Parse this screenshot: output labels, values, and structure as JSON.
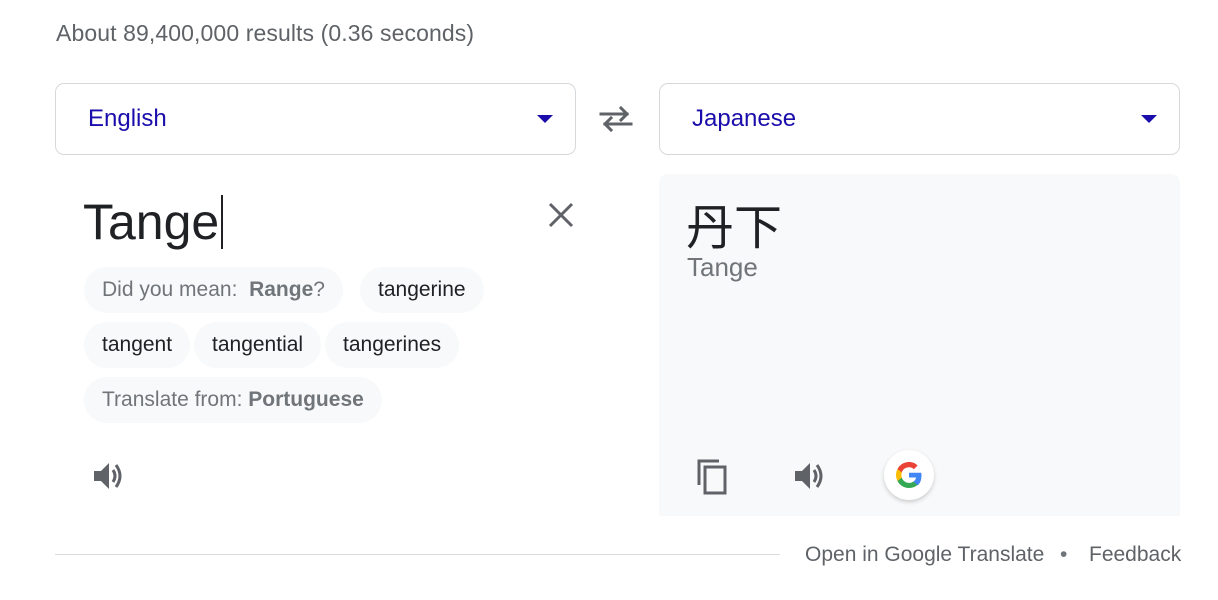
{
  "results_stats": "About 89,400,000 results (0.36 seconds)",
  "source_language": {
    "label": "English"
  },
  "target_language": {
    "label": "Japanese"
  },
  "source": {
    "text": "Tange",
    "did_you_mean_prefix": "Did you mean:",
    "did_you_mean_word": "Range",
    "did_you_mean_suffix": "?",
    "suggestions": [
      "tangerine",
      "tangent",
      "tangential",
      "tangerines"
    ],
    "translate_from_prefix": "Translate from:",
    "translate_from_language": "Portuguese"
  },
  "target": {
    "text": "丹下",
    "transliteration": "Tange"
  },
  "footer": {
    "open_link": "Open in Google Translate",
    "separator": "•",
    "feedback": "Feedback"
  },
  "colors": {
    "link_blue": "#1a0dab",
    "text_gray": "#5f6368",
    "panel_bg": "#f8f9fa"
  },
  "icons": [
    "swap-icon",
    "close-icon",
    "speaker-icon",
    "copy-icon",
    "google-logo-icon"
  ]
}
